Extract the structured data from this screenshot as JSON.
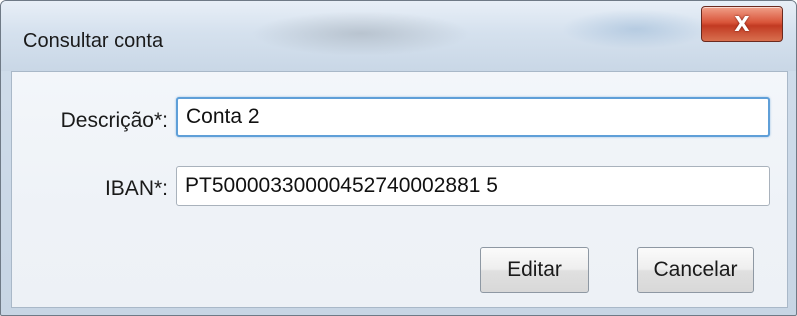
{
  "window": {
    "title": "Consultar conta",
    "close_glyph": "X"
  },
  "form": {
    "description_label": "Descrição*:",
    "description_value": "Conta 2",
    "iban_label": "IBAN*:",
    "iban_value": "PT50000330000452740002881 5"
  },
  "buttons": {
    "edit_label": "Editar",
    "cancel_label": "Cancelar"
  },
  "colors": {
    "focus_border": "#5f9fd8",
    "close_button": "#c23a22"
  }
}
